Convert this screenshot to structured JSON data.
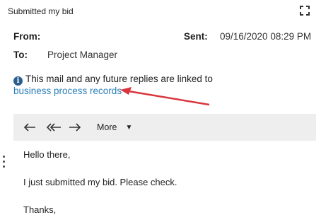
{
  "window": {
    "title": "Submitted my bid",
    "expand_icon": "expand-corners-icon"
  },
  "header": {
    "from_label": "From:",
    "sent_label": "Sent:",
    "sent_value": "09/16/2020 08:29 PM",
    "to_label": "To:",
    "to_value": "Project Manager"
  },
  "notice": {
    "icon": "info-icon",
    "icon_glyph": "i",
    "text": "This mail and any future replies are linked to",
    "link_text": "business process records"
  },
  "toolbar": {
    "reply_icon": "reply-icon",
    "reply_all_icon": "reply-all-icon",
    "forward_icon": "forward-icon",
    "more_label": "More",
    "more_caret": "▼"
  },
  "message": {
    "lines": [
      "Hello there,",
      "I just submitted my bid. Please check.",
      "Thanks,"
    ]
  },
  "colors": {
    "link": "#2c7fb8",
    "annotation_arrow": "#d9363e",
    "toolbar_bg": "#eeeeee"
  }
}
